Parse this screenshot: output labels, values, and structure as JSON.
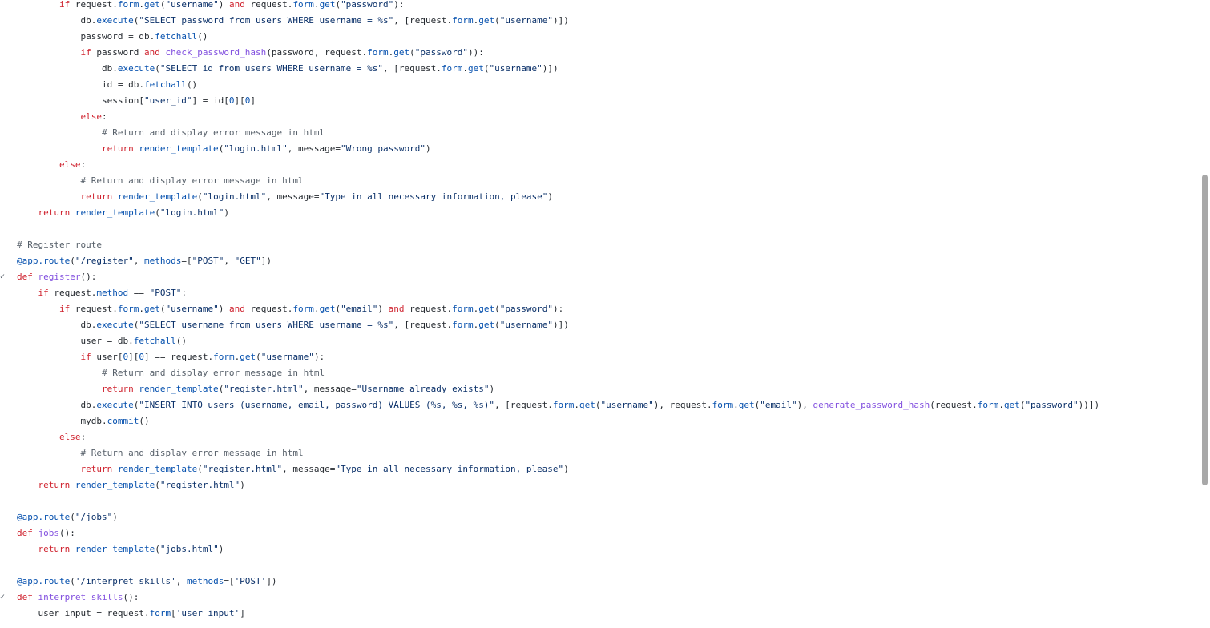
{
  "fold_glyph": "✓",
  "lines": [
    {
      "indent": "        ",
      "fold": false,
      "segments": [
        {
          "t": "if",
          "c": "k"
        },
        {
          "t": " request.",
          "c": "t"
        },
        {
          "t": "form",
          "c": "a"
        },
        {
          "t": ".",
          "c": "t"
        },
        {
          "t": "get",
          "c": "a"
        },
        {
          "t": "(",
          "c": "t"
        },
        {
          "t": "\"username\"",
          "c": "s"
        },
        {
          "t": ") ",
          "c": "t"
        },
        {
          "t": "and",
          "c": "k"
        },
        {
          "t": " request.",
          "c": "t"
        },
        {
          "t": "form",
          "c": "a"
        },
        {
          "t": ".",
          "c": "t"
        },
        {
          "t": "get",
          "c": "a"
        },
        {
          "t": "(",
          "c": "t"
        },
        {
          "t": "\"password\"",
          "c": "s"
        },
        {
          "t": "):",
          "c": "t"
        }
      ]
    },
    {
      "indent": "            ",
      "fold": false,
      "segments": [
        {
          "t": "db.",
          "c": "t"
        },
        {
          "t": "execute",
          "c": "a"
        },
        {
          "t": "(",
          "c": "t"
        },
        {
          "t": "\"SELECT password from users WHERE username = %s\"",
          "c": "s"
        },
        {
          "t": ", [request.",
          "c": "t"
        },
        {
          "t": "form",
          "c": "a"
        },
        {
          "t": ".",
          "c": "t"
        },
        {
          "t": "get",
          "c": "a"
        },
        {
          "t": "(",
          "c": "t"
        },
        {
          "t": "\"username\"",
          "c": "s"
        },
        {
          "t": ")])",
          "c": "t"
        }
      ]
    },
    {
      "indent": "            ",
      "fold": false,
      "segments": [
        {
          "t": "password = db.",
          "c": "t"
        },
        {
          "t": "fetchall",
          "c": "a"
        },
        {
          "t": "()",
          "c": "t"
        }
      ]
    },
    {
      "indent": "            ",
      "fold": false,
      "segments": [
        {
          "t": "if",
          "c": "k"
        },
        {
          "t": " password ",
          "c": "t"
        },
        {
          "t": "and",
          "c": "k"
        },
        {
          "t": " ",
          "c": "t"
        },
        {
          "t": "check_password_hash",
          "c": "f"
        },
        {
          "t": "(password, request.",
          "c": "t"
        },
        {
          "t": "form",
          "c": "a"
        },
        {
          "t": ".",
          "c": "t"
        },
        {
          "t": "get",
          "c": "a"
        },
        {
          "t": "(",
          "c": "t"
        },
        {
          "t": "\"password\"",
          "c": "s"
        },
        {
          "t": ")):",
          "c": "t"
        }
      ]
    },
    {
      "indent": "                ",
      "fold": false,
      "segments": [
        {
          "t": "db.",
          "c": "t"
        },
        {
          "t": "execute",
          "c": "a"
        },
        {
          "t": "(",
          "c": "t"
        },
        {
          "t": "\"SELECT id from users WHERE username = %s\"",
          "c": "s"
        },
        {
          "t": ", [request.",
          "c": "t"
        },
        {
          "t": "form",
          "c": "a"
        },
        {
          "t": ".",
          "c": "t"
        },
        {
          "t": "get",
          "c": "a"
        },
        {
          "t": "(",
          "c": "t"
        },
        {
          "t": "\"username\"",
          "c": "s"
        },
        {
          "t": ")])",
          "c": "t"
        }
      ]
    },
    {
      "indent": "                ",
      "fold": false,
      "segments": [
        {
          "t": "id = db.",
          "c": "t"
        },
        {
          "t": "fetchall",
          "c": "a"
        },
        {
          "t": "()",
          "c": "t"
        }
      ]
    },
    {
      "indent": "                ",
      "fold": false,
      "segments": [
        {
          "t": "session[",
          "c": "t"
        },
        {
          "t": "\"user_id\"",
          "c": "s"
        },
        {
          "t": "] = id[",
          "c": "t"
        },
        {
          "t": "0",
          "c": "a"
        },
        {
          "t": "][",
          "c": "t"
        },
        {
          "t": "0",
          "c": "a"
        },
        {
          "t": "]",
          "c": "t"
        }
      ]
    },
    {
      "indent": "            ",
      "fold": false,
      "segments": [
        {
          "t": "else",
          "c": "k"
        },
        {
          "t": ":",
          "c": "t"
        }
      ]
    },
    {
      "indent": "                ",
      "fold": false,
      "segments": [
        {
          "t": "# Return and display error message in html",
          "c": "c"
        }
      ]
    },
    {
      "indent": "                ",
      "fold": false,
      "segments": [
        {
          "t": "return",
          "c": "k"
        },
        {
          "t": " ",
          "c": "t"
        },
        {
          "t": "render_template",
          "c": "a"
        },
        {
          "t": "(",
          "c": "t"
        },
        {
          "t": "\"login.html\"",
          "c": "s"
        },
        {
          "t": ", message=",
          "c": "t"
        },
        {
          "t": "\"Wrong password\"",
          "c": "s"
        },
        {
          "t": ")",
          "c": "t"
        }
      ]
    },
    {
      "indent": "        ",
      "fold": false,
      "segments": [
        {
          "t": "else",
          "c": "k"
        },
        {
          "t": ":",
          "c": "t"
        }
      ]
    },
    {
      "indent": "            ",
      "fold": false,
      "segments": [
        {
          "t": "# Return and display error message in html",
          "c": "c"
        }
      ]
    },
    {
      "indent": "            ",
      "fold": false,
      "segments": [
        {
          "t": "return",
          "c": "k"
        },
        {
          "t": " ",
          "c": "t"
        },
        {
          "t": "render_template",
          "c": "a"
        },
        {
          "t": "(",
          "c": "t"
        },
        {
          "t": "\"login.html\"",
          "c": "s"
        },
        {
          "t": ", message=",
          "c": "t"
        },
        {
          "t": "\"Type in all necessary information, please\"",
          "c": "s"
        },
        {
          "t": ")",
          "c": "t"
        }
      ]
    },
    {
      "indent": "    ",
      "fold": false,
      "segments": [
        {
          "t": "return",
          "c": "k"
        },
        {
          "t": " ",
          "c": "t"
        },
        {
          "t": "render_template",
          "c": "a"
        },
        {
          "t": "(",
          "c": "t"
        },
        {
          "t": "\"login.html\"",
          "c": "s"
        },
        {
          "t": ")",
          "c": "t"
        }
      ]
    },
    {
      "indent": "",
      "fold": false,
      "segments": []
    },
    {
      "indent": "",
      "fold": false,
      "segments": [
        {
          "t": "# Register route",
          "c": "c"
        }
      ]
    },
    {
      "indent": "",
      "fold": false,
      "segments": [
        {
          "t": "@app.route",
          "c": "a"
        },
        {
          "t": "(",
          "c": "t"
        },
        {
          "t": "\"/register\"",
          "c": "s"
        },
        {
          "t": ", ",
          "c": "t"
        },
        {
          "t": "methods",
          "c": "a"
        },
        {
          "t": "=[",
          "c": "t"
        },
        {
          "t": "\"POST\"",
          "c": "s"
        },
        {
          "t": ", ",
          "c": "t"
        },
        {
          "t": "\"GET\"",
          "c": "s"
        },
        {
          "t": "])",
          "c": "t"
        }
      ]
    },
    {
      "indent": "",
      "fold": true,
      "segments": [
        {
          "t": "def",
          "c": "k"
        },
        {
          "t": " ",
          "c": "t"
        },
        {
          "t": "register",
          "c": "f"
        },
        {
          "t": "():",
          "c": "t"
        }
      ]
    },
    {
      "indent": "    ",
      "fold": false,
      "segments": [
        {
          "t": "if",
          "c": "k"
        },
        {
          "t": " request.",
          "c": "t"
        },
        {
          "t": "method",
          "c": "a"
        },
        {
          "t": " == ",
          "c": "t"
        },
        {
          "t": "\"POST\"",
          "c": "s"
        },
        {
          "t": ":",
          "c": "t"
        }
      ]
    },
    {
      "indent": "        ",
      "fold": false,
      "segments": [
        {
          "t": "if",
          "c": "k"
        },
        {
          "t": " request.",
          "c": "t"
        },
        {
          "t": "form",
          "c": "a"
        },
        {
          "t": ".",
          "c": "t"
        },
        {
          "t": "get",
          "c": "a"
        },
        {
          "t": "(",
          "c": "t"
        },
        {
          "t": "\"username\"",
          "c": "s"
        },
        {
          "t": ") ",
          "c": "t"
        },
        {
          "t": "and",
          "c": "k"
        },
        {
          "t": " request.",
          "c": "t"
        },
        {
          "t": "form",
          "c": "a"
        },
        {
          "t": ".",
          "c": "t"
        },
        {
          "t": "get",
          "c": "a"
        },
        {
          "t": "(",
          "c": "t"
        },
        {
          "t": "\"email\"",
          "c": "s"
        },
        {
          "t": ") ",
          "c": "t"
        },
        {
          "t": "and",
          "c": "k"
        },
        {
          "t": " request.",
          "c": "t"
        },
        {
          "t": "form",
          "c": "a"
        },
        {
          "t": ".",
          "c": "t"
        },
        {
          "t": "get",
          "c": "a"
        },
        {
          "t": "(",
          "c": "t"
        },
        {
          "t": "\"password\"",
          "c": "s"
        },
        {
          "t": "):",
          "c": "t"
        }
      ]
    },
    {
      "indent": "            ",
      "fold": false,
      "segments": [
        {
          "t": "db.",
          "c": "t"
        },
        {
          "t": "execute",
          "c": "a"
        },
        {
          "t": "(",
          "c": "t"
        },
        {
          "t": "\"SELECT username from users WHERE username = %s\"",
          "c": "s"
        },
        {
          "t": ", [request.",
          "c": "t"
        },
        {
          "t": "form",
          "c": "a"
        },
        {
          "t": ".",
          "c": "t"
        },
        {
          "t": "get",
          "c": "a"
        },
        {
          "t": "(",
          "c": "t"
        },
        {
          "t": "\"username\"",
          "c": "s"
        },
        {
          "t": ")])",
          "c": "t"
        }
      ]
    },
    {
      "indent": "            ",
      "fold": false,
      "segments": [
        {
          "t": "user = db.",
          "c": "t"
        },
        {
          "t": "fetchall",
          "c": "a"
        },
        {
          "t": "()",
          "c": "t"
        }
      ]
    },
    {
      "indent": "            ",
      "fold": false,
      "segments": [
        {
          "t": "if",
          "c": "k"
        },
        {
          "t": " user[",
          "c": "t"
        },
        {
          "t": "0",
          "c": "a"
        },
        {
          "t": "][",
          "c": "t"
        },
        {
          "t": "0",
          "c": "a"
        },
        {
          "t": "] == request.",
          "c": "t"
        },
        {
          "t": "form",
          "c": "a"
        },
        {
          "t": ".",
          "c": "t"
        },
        {
          "t": "get",
          "c": "a"
        },
        {
          "t": "(",
          "c": "t"
        },
        {
          "t": "\"username\"",
          "c": "s"
        },
        {
          "t": "):",
          "c": "t"
        }
      ]
    },
    {
      "indent": "                ",
      "fold": false,
      "segments": [
        {
          "t": "# Return and display error message in html",
          "c": "c"
        }
      ]
    },
    {
      "indent": "                ",
      "fold": false,
      "segments": [
        {
          "t": "return",
          "c": "k"
        },
        {
          "t": " ",
          "c": "t"
        },
        {
          "t": "render_template",
          "c": "a"
        },
        {
          "t": "(",
          "c": "t"
        },
        {
          "t": "\"register.html\"",
          "c": "s"
        },
        {
          "t": ", message=",
          "c": "t"
        },
        {
          "t": "\"Username already exists\"",
          "c": "s"
        },
        {
          "t": ")",
          "c": "t"
        }
      ]
    },
    {
      "indent": "            ",
      "fold": false,
      "segments": [
        {
          "t": "db.",
          "c": "t"
        },
        {
          "t": "execute",
          "c": "a"
        },
        {
          "t": "(",
          "c": "t"
        },
        {
          "t": "\"INSERT INTO users (username, email, password) VALUES (%s, %s, %s)\"",
          "c": "s"
        },
        {
          "t": ", [request.",
          "c": "t"
        },
        {
          "t": "form",
          "c": "a"
        },
        {
          "t": ".",
          "c": "t"
        },
        {
          "t": "get",
          "c": "a"
        },
        {
          "t": "(",
          "c": "t"
        },
        {
          "t": "\"username\"",
          "c": "s"
        },
        {
          "t": "), request.",
          "c": "t"
        },
        {
          "t": "form",
          "c": "a"
        },
        {
          "t": ".",
          "c": "t"
        },
        {
          "t": "get",
          "c": "a"
        },
        {
          "t": "(",
          "c": "t"
        },
        {
          "t": "\"email\"",
          "c": "s"
        },
        {
          "t": "), ",
          "c": "t"
        },
        {
          "t": "generate_password_hash",
          "c": "f"
        },
        {
          "t": "(request.",
          "c": "t"
        },
        {
          "t": "form",
          "c": "a"
        },
        {
          "t": ".",
          "c": "t"
        },
        {
          "t": "get",
          "c": "a"
        },
        {
          "t": "(",
          "c": "t"
        },
        {
          "t": "\"password\"",
          "c": "s"
        },
        {
          "t": "))])",
          "c": "t"
        }
      ]
    },
    {
      "indent": "            ",
      "fold": false,
      "segments": [
        {
          "t": "mydb.",
          "c": "t"
        },
        {
          "t": "commit",
          "c": "a"
        },
        {
          "t": "()",
          "c": "t"
        }
      ]
    },
    {
      "indent": "        ",
      "fold": false,
      "segments": [
        {
          "t": "else",
          "c": "k"
        },
        {
          "t": ":",
          "c": "t"
        }
      ]
    },
    {
      "indent": "            ",
      "fold": false,
      "segments": [
        {
          "t": "# Return and display error message in html",
          "c": "c"
        }
      ]
    },
    {
      "indent": "            ",
      "fold": false,
      "segments": [
        {
          "t": "return",
          "c": "k"
        },
        {
          "t": " ",
          "c": "t"
        },
        {
          "t": "render_template",
          "c": "a"
        },
        {
          "t": "(",
          "c": "t"
        },
        {
          "t": "\"register.html\"",
          "c": "s"
        },
        {
          "t": ", message=",
          "c": "t"
        },
        {
          "t": "\"Type in all necessary information, please\"",
          "c": "s"
        },
        {
          "t": ")",
          "c": "t"
        }
      ]
    },
    {
      "indent": "    ",
      "fold": false,
      "segments": [
        {
          "t": "return",
          "c": "k"
        },
        {
          "t": " ",
          "c": "t"
        },
        {
          "t": "render_template",
          "c": "a"
        },
        {
          "t": "(",
          "c": "t"
        },
        {
          "t": "\"register.html\"",
          "c": "s"
        },
        {
          "t": ")",
          "c": "t"
        }
      ]
    },
    {
      "indent": "",
      "fold": false,
      "segments": []
    },
    {
      "indent": "",
      "fold": false,
      "segments": [
        {
          "t": "@app.route",
          "c": "a"
        },
        {
          "t": "(",
          "c": "t"
        },
        {
          "t": "\"/jobs\"",
          "c": "s"
        },
        {
          "t": ")",
          "c": "t"
        }
      ]
    },
    {
      "indent": "",
      "fold": false,
      "segments": [
        {
          "t": "def",
          "c": "k"
        },
        {
          "t": " ",
          "c": "t"
        },
        {
          "t": "jobs",
          "c": "f"
        },
        {
          "t": "():",
          "c": "t"
        }
      ]
    },
    {
      "indent": "    ",
      "fold": false,
      "segments": [
        {
          "t": "return",
          "c": "k"
        },
        {
          "t": " ",
          "c": "t"
        },
        {
          "t": "render_template",
          "c": "a"
        },
        {
          "t": "(",
          "c": "t"
        },
        {
          "t": "\"jobs.html\"",
          "c": "s"
        },
        {
          "t": ")",
          "c": "t"
        }
      ]
    },
    {
      "indent": "",
      "fold": false,
      "segments": []
    },
    {
      "indent": "",
      "fold": false,
      "segments": [
        {
          "t": "@app.route",
          "c": "a"
        },
        {
          "t": "(",
          "c": "t"
        },
        {
          "t": "'/interpret_skills'",
          "c": "s"
        },
        {
          "t": ", ",
          "c": "t"
        },
        {
          "t": "methods",
          "c": "a"
        },
        {
          "t": "=[",
          "c": "t"
        },
        {
          "t": "'POST'",
          "c": "s"
        },
        {
          "t": "])",
          "c": "t"
        }
      ]
    },
    {
      "indent": "",
      "fold": true,
      "segments": [
        {
          "t": "def",
          "c": "k"
        },
        {
          "t": " ",
          "c": "t"
        },
        {
          "t": "interpret_skills",
          "c": "f"
        },
        {
          "t": "():",
          "c": "t"
        }
      ]
    },
    {
      "indent": "    ",
      "fold": false,
      "segments": [
        {
          "t": "user_input = request.",
          "c": "t"
        },
        {
          "t": "form",
          "c": "a"
        },
        {
          "t": "[",
          "c": "t"
        },
        {
          "t": "'user_input'",
          "c": "s"
        },
        {
          "t": "]",
          "c": "t"
        }
      ]
    }
  ]
}
